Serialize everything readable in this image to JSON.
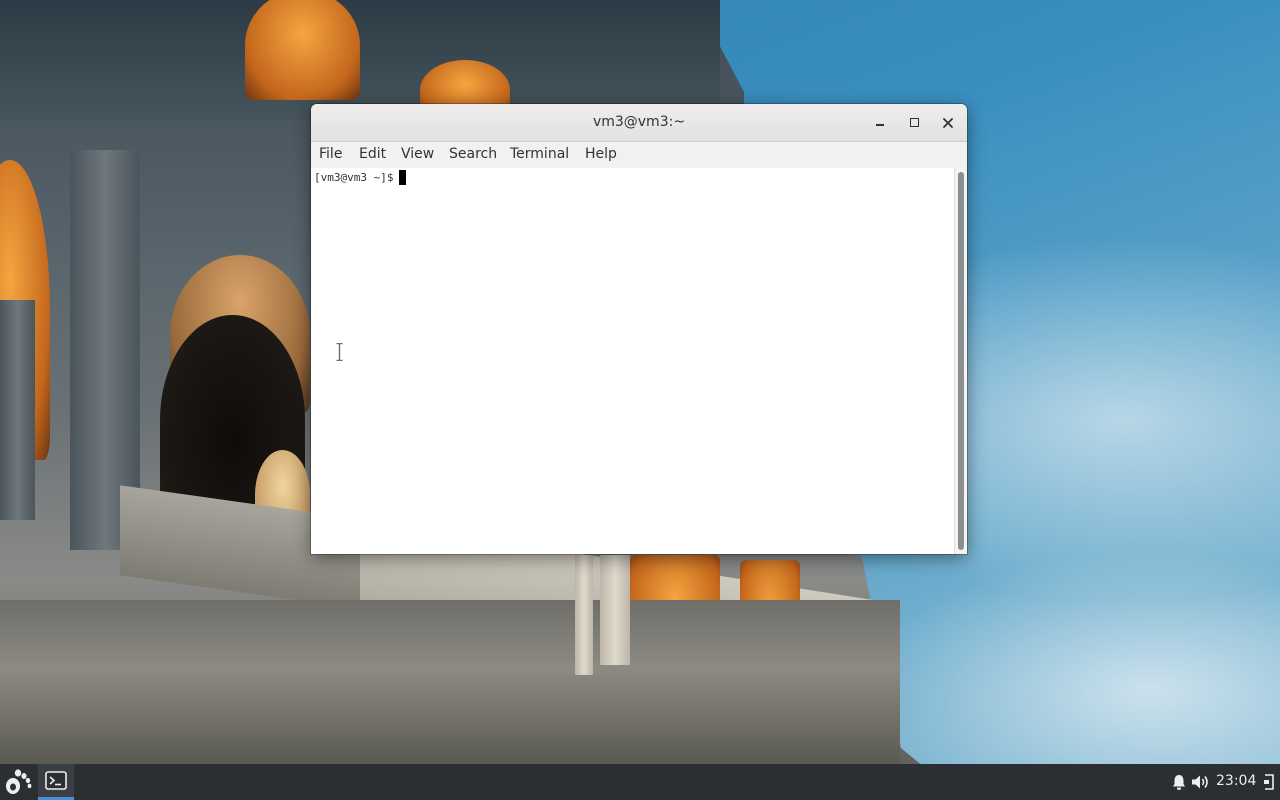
{
  "window": {
    "title": "vm3@vm3:~",
    "controls": {
      "minimize": "minimize-icon",
      "maximize": "maximize-icon",
      "close": "close-icon"
    }
  },
  "menubar": {
    "items": [
      "File",
      "Edit",
      "View",
      "Search",
      "Terminal",
      "Help"
    ]
  },
  "terminal": {
    "prompt": "[vm3@vm3 ~]$"
  },
  "taskbar": {
    "apps_icon": "gnome-foot-icon",
    "running": [
      {
        "name": "Terminal",
        "icon": "terminal-icon",
        "active": true
      }
    ],
    "tray": {
      "notification_icon": "bell-icon",
      "volume_icon": "volume-icon",
      "clock": "23:04",
      "exit_icon": "logout-icon"
    }
  },
  "colors": {
    "taskbar_bg": "#2b2e33",
    "active_indicator": "#4a90d9",
    "titlebar_bg": "#e8e7e6"
  }
}
